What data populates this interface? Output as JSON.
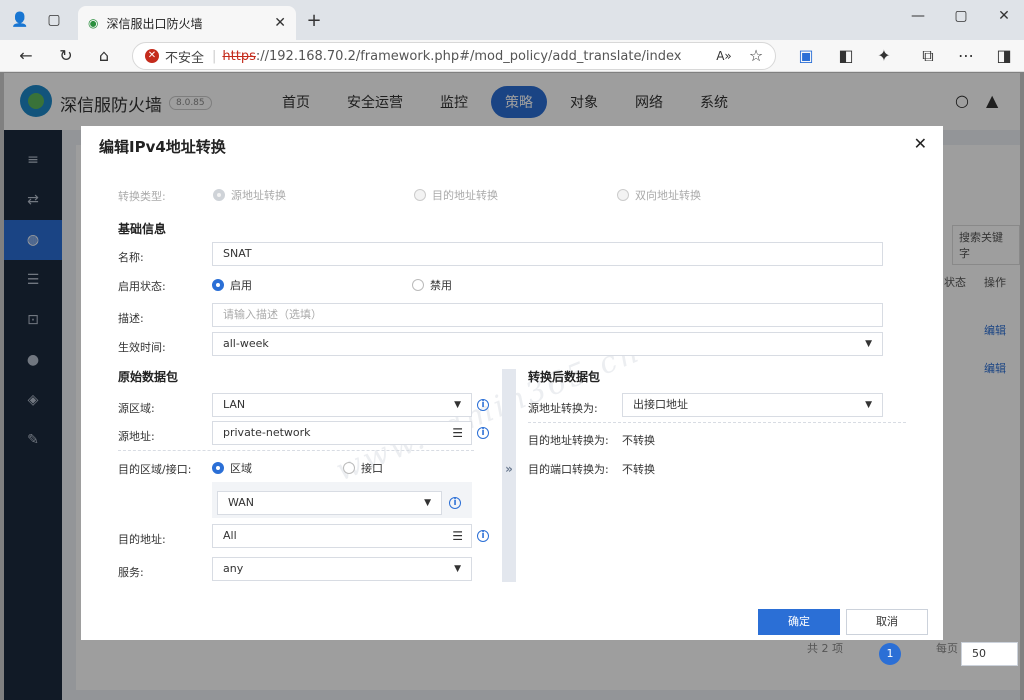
{
  "browser": {
    "tab_title": "深信服出口防火墙",
    "security_label": "不安全",
    "url_scheme": "https",
    "url_rest": "://192.168.70.2/framework.php#/mod_policy/add_translate/index"
  },
  "app": {
    "title": "深信服防火墙",
    "version": "8.0.85",
    "nav": [
      "首页",
      "安全运营",
      "监控",
      "策略",
      "对象",
      "网络",
      "系统"
    ],
    "active_nav": "策略"
  },
  "background": {
    "search_placeholder": "搜索关键字",
    "col_status": "状态",
    "col_action": "操作",
    "edit1": "编辑",
    "edit2": "编辑",
    "total": "共 2 项",
    "page": "1",
    "per_page_label": "每页",
    "per_page_value": "50"
  },
  "modal": {
    "title": "编辑IPv4地址转换",
    "type_label": "转换类型:",
    "type_options": [
      "源地址转换",
      "目的地址转换",
      "双向地址转换"
    ],
    "basic_section": "基础信息",
    "name_label": "名称:",
    "name_value": "SNAT",
    "status_label": "启用状态:",
    "status_on": "启用",
    "status_off": "禁用",
    "desc_label": "描述:",
    "desc_placeholder": "请输入描述（选填）",
    "schedule_label": "生效时间:",
    "schedule_value": "all-week",
    "orig_section": "原始数据包",
    "src_zone_label": "源区域:",
    "src_zone_value": "LAN",
    "src_addr_label": "源地址:",
    "src_addr_value": "private-network",
    "dst_zone_label": "目的区域/接口:",
    "dst_zone_opt": "区域",
    "dst_if_opt": "接口",
    "dst_zone_value": "WAN",
    "dst_addr_label": "目的地址:",
    "dst_addr_value": "All",
    "service_label": "服务:",
    "service_value": "any",
    "trans_section": "转换后数据包",
    "src_trans_label": "源地址转换为:",
    "src_trans_value": "出接口地址",
    "dst_trans_label": "目的地址转换为:",
    "dst_trans_value": "不转换",
    "port_trans_label": "目的端口转换为:",
    "port_trans_value": "不转换",
    "ok_label": "确定",
    "cancel_label": "取消"
  },
  "watermark": "www.admin365.cn",
  "colors": {
    "accent": "#2b6fd6",
    "sidebar": "#1c2a3e"
  }
}
